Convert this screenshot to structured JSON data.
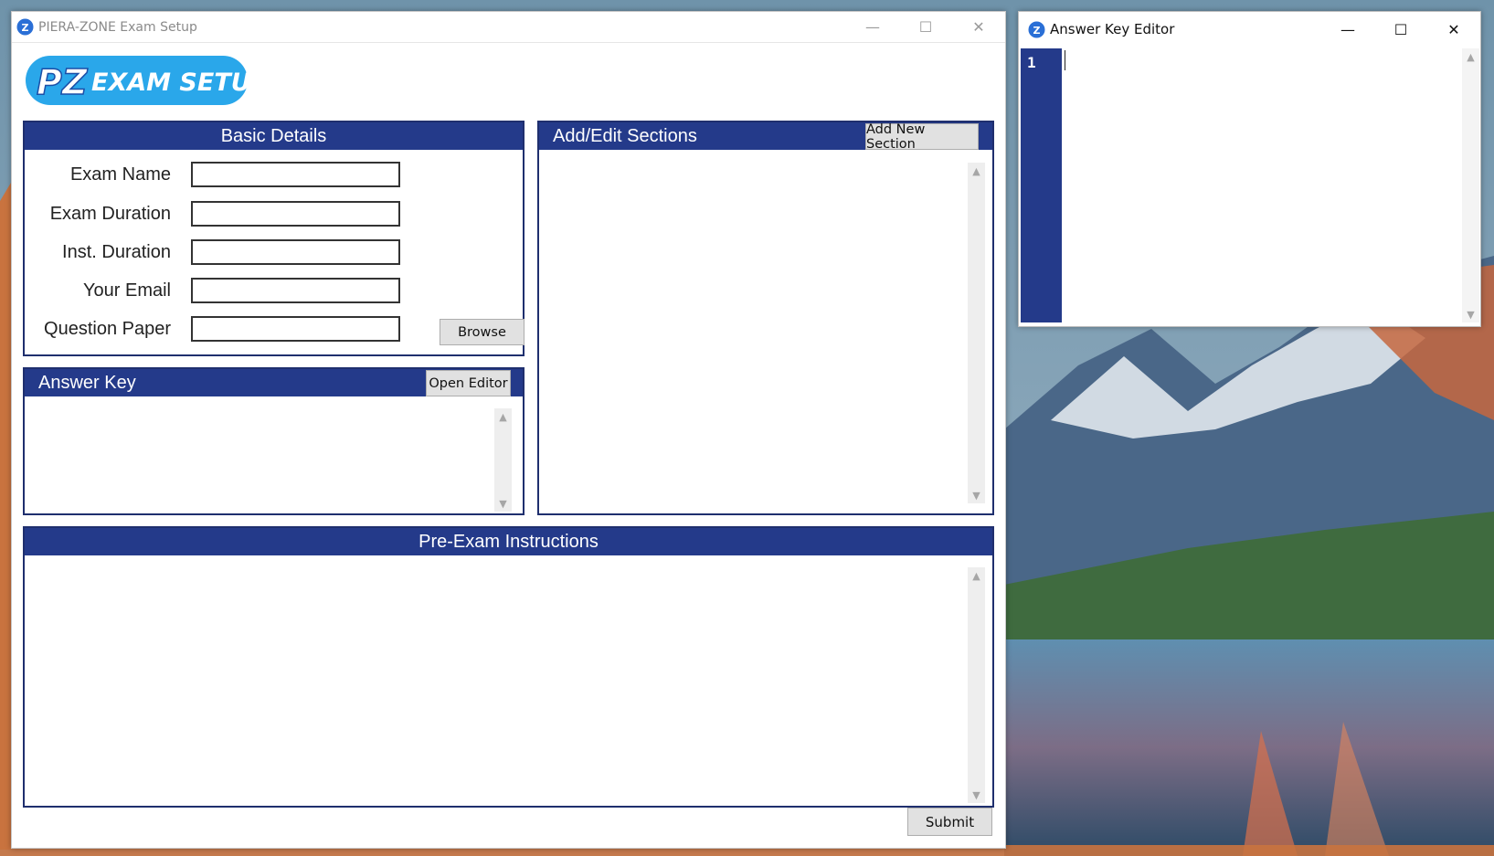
{
  "main_window": {
    "title": "PIERA-ZONE Exam Setup",
    "logo_text": "PZ EXAM SETUP",
    "controls": {
      "minimize": "—",
      "maximize": "☐",
      "close": "✕"
    }
  },
  "basic_details": {
    "header": "Basic Details",
    "fields": [
      {
        "label": "Exam Name",
        "value": ""
      },
      {
        "label": "Exam Duration",
        "value": ""
      },
      {
        "label": "Inst. Duration",
        "value": ""
      },
      {
        "label": "Your Email",
        "value": ""
      },
      {
        "label": "Question Paper",
        "value": ""
      }
    ],
    "browse_label": "Browse"
  },
  "answer_key": {
    "header": "Answer Key",
    "open_editor_label": "Open Editor"
  },
  "sections": {
    "header": "Add/Edit Sections",
    "add_label": "Add New Section"
  },
  "instructions": {
    "header": "Pre-Exam Instructions"
  },
  "submit_label": "Submit",
  "editor_window": {
    "title": "Answer Key Editor",
    "line_number": "1",
    "controls": {
      "minimize": "—",
      "maximize": "☐",
      "close": "✕"
    }
  },
  "colors": {
    "panel_header": "#243a8a",
    "panel_border": "#1f2f6e",
    "logo_bg": "#2aa7ea"
  }
}
